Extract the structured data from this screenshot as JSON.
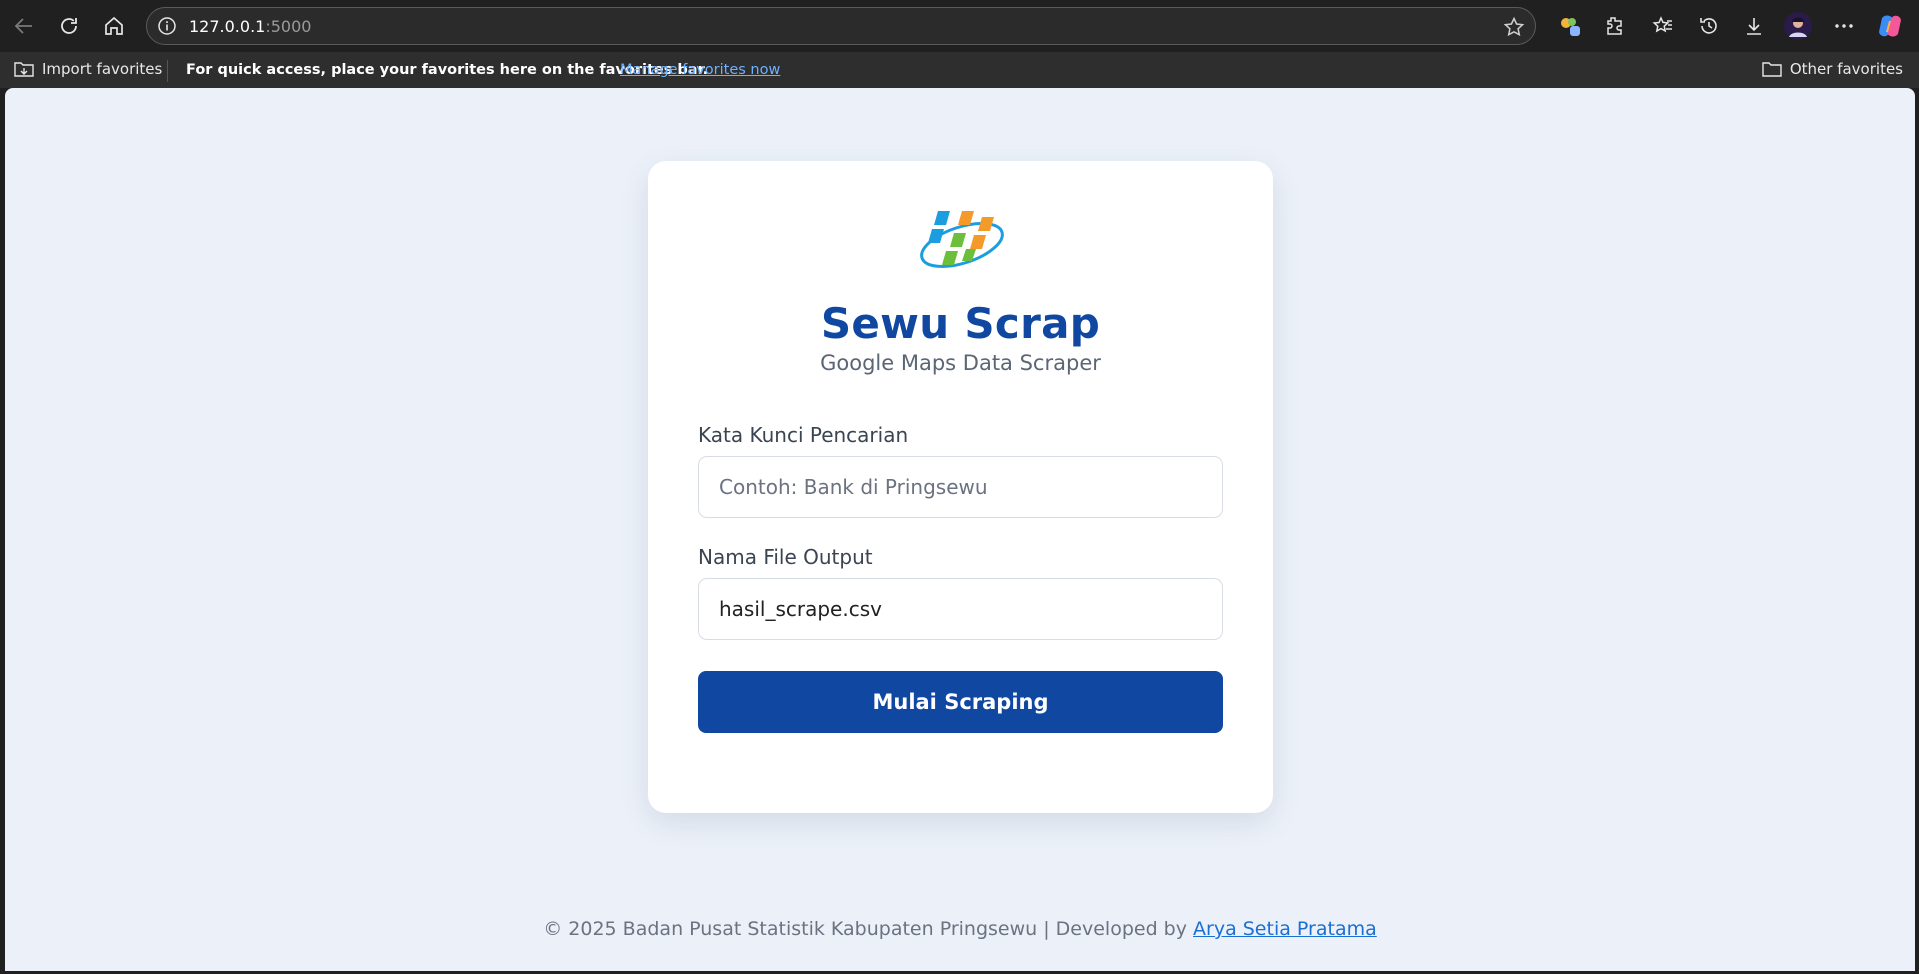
{
  "browser": {
    "url_host": "127.0.0.1",
    "url_port": ":5000",
    "favorites_bar": {
      "import_label": "Import favorites",
      "message": "For quick access, place your favorites here on the favorites bar.",
      "manage_link": "Manage favorites now",
      "other_label": "Other favorites"
    }
  },
  "app": {
    "title": "Sewu Scrap",
    "subtitle": "Google Maps Data Scraper",
    "keyword_label": "Kata Kunci Pencarian",
    "keyword_placeholder": "Contoh: Bank di Pringsewu",
    "keyword_value": "",
    "filename_label": "Nama File Output",
    "filename_value": "hasil_scrape.csv",
    "submit_label": "Mulai Scraping",
    "brand_colors": {
      "primary": "#0f47a1",
      "logo_blue": "#1a9ee0",
      "logo_orange": "#f39a2b",
      "logo_green": "#6cbf3b"
    }
  },
  "footer": {
    "text": "© 2025 Badan Pusat Statistik Kabupaten Pringsewu | Developed by ",
    "author_link": "Arya Setia Pratama"
  }
}
